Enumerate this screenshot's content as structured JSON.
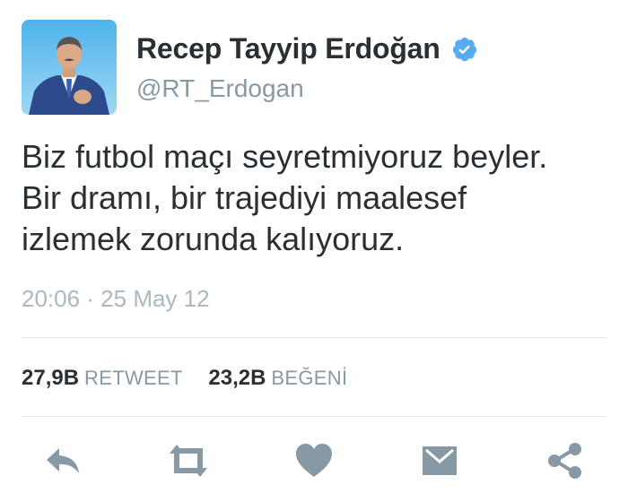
{
  "user": {
    "display_name": "Recep Tayyip Erdoğan",
    "handle": "@RT_Erdogan",
    "verified": true
  },
  "tweet": {
    "lines": [
      "Biz futbol maçı seyretmiyoruz beyler.",
      "Bir dramı, bir trajediyi maalesef",
      "izlemek zorunda kalıyoruz."
    ],
    "timestamp": "20:06 · 25 May 12"
  },
  "stats": {
    "retweets": {
      "count": "27,9B",
      "label": "RETWEET"
    },
    "likes": {
      "count": "23,2B",
      "label": "BEĞENİ"
    }
  },
  "actions": [
    {
      "name": "reply",
      "icon": "reply-icon"
    },
    {
      "name": "retweet",
      "icon": "retweet-icon"
    },
    {
      "name": "like",
      "icon": "heart-icon"
    },
    {
      "name": "message",
      "icon": "envelope-icon"
    },
    {
      "name": "share",
      "icon": "share-icon"
    }
  ],
  "colors": {
    "text": "#292f33",
    "secondary": "#8899a6",
    "timestamp": "#aab8c2",
    "divider": "#e1e8ed",
    "icon": "#8899a6",
    "verified": "#55acee"
  }
}
